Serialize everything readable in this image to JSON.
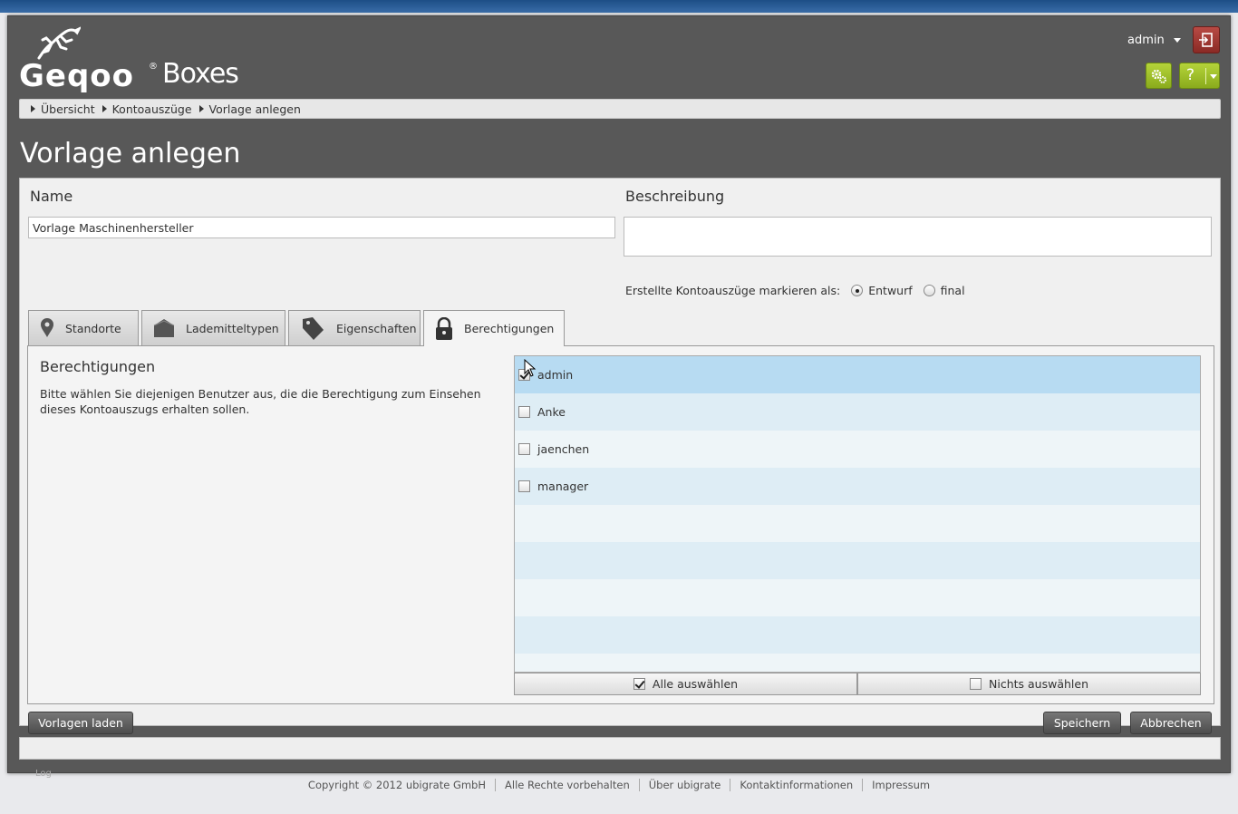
{
  "app": {
    "brand": "Geqoo",
    "brand_mark": "®",
    "product": "Boxes"
  },
  "header": {
    "user": "admin",
    "help_label": "?"
  },
  "breadcrumb": [
    "Übersicht",
    "Kontoauszüge",
    "Vorlage anlegen"
  ],
  "page_title": "Vorlage anlegen",
  "form": {
    "name_label": "Name",
    "name_value": "Vorlage Maschinenhersteller",
    "desc_label": "Beschreibung",
    "desc_value": "",
    "mark_label": "Erstellte Kontoauszüge markieren als:",
    "mark_options": [
      "Entwurf",
      "final"
    ],
    "mark_selected": "Entwurf"
  },
  "tabs": [
    {
      "label": "Standorte",
      "icon": "map-pin-icon"
    },
    {
      "label": "Lademitteltypen",
      "icon": "box-icon"
    },
    {
      "label": "Eigenschaften",
      "icon": "tag-icon"
    },
    {
      "label": "Berechtigungen",
      "icon": "lock-icon",
      "active": true
    }
  ],
  "permissions": {
    "title": "Berechtigungen",
    "description": "Bitte wählen Sie diejenigen Benutzer aus, die die Berechtigung zum Einsehen dieses Kontoauszugs erhalten sollen.",
    "users": [
      {
        "name": "admin",
        "checked": true
      },
      {
        "name": "Anke",
        "checked": false
      },
      {
        "name": "jaenchen",
        "checked": false
      },
      {
        "name": "manager",
        "checked": false
      }
    ],
    "select_all": "Alle auswählen",
    "select_none": "Nichts auswählen"
  },
  "buttons": {
    "load": "Vorlagen laden",
    "save": "Speichern",
    "cancel": "Abbrechen"
  },
  "log_label": "Log",
  "footer": [
    "Copyright © 2012 ubigrate GmbH",
    "Alle Rechte vorbehalten",
    "Über ubigrate",
    "Kontaktinformationen",
    "Impressum"
  ],
  "colors": {
    "accent_green": "#9bbd27",
    "logout_red": "#a13a34",
    "header_bg": "#585858",
    "row_selected": "#b7dbf2"
  }
}
